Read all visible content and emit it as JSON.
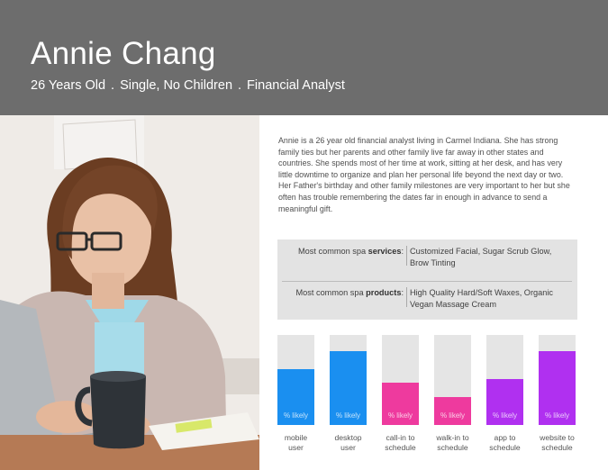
{
  "header": {
    "name": "Annie Chang",
    "age": "26 Years Old",
    "status": "Single, No Children",
    "occupation": "Financial Analyst",
    "separator": "."
  },
  "bio": "Annie is a 26 year old financial analyst living in Carmel Indiana. She has strong family ties but her parents and other family live far away in other states and countries. She spends most of her time at work, sitting at her desk, and has very little downtime to organize and plan her personal life beyond the next day or two. Her Father's birthday and other family milestones are very important to her but she often has trouble remembering the dates far in enough in advance to send a meaningful gift.",
  "spa": {
    "services_prefix": "Most common spa ",
    "services_bold": "services",
    "services_value": "Customized Facial, Sugar Scrub Glow, Brow Tinting",
    "products_prefix": "Most common spa ",
    "products_bold": "products",
    "products_value": "High Quality Hard/Soft Waxes, Organic Vegan Massage Cream",
    "colon": ":"
  },
  "chart_data": {
    "type": "bar",
    "categories": [
      "mobile user",
      "desktop user",
      "call-in to schedule",
      "walk-in to schedule",
      "app to schedule",
      "website to schedule"
    ],
    "label_lines": [
      [
        "mobile",
        "user"
      ],
      [
        "desktop",
        "user"
      ],
      [
        "call-in to",
        "schedule"
      ],
      [
        "walk-in to",
        "schedule"
      ],
      [
        "app to",
        "schedule"
      ],
      [
        "website to",
        "schedule"
      ]
    ],
    "values": [
      62,
      82,
      47,
      31,
      51,
      82
    ],
    "colors": [
      "#1a8ff0",
      "#1a8ff0",
      "#ee3a9e",
      "#ee3a9e",
      "#b030f0",
      "#b030f0"
    ],
    "bar_text": "% likely",
    "ylim": [
      0,
      100
    ]
  },
  "icons": {
    "photo": "person-at-laptop-photo"
  }
}
